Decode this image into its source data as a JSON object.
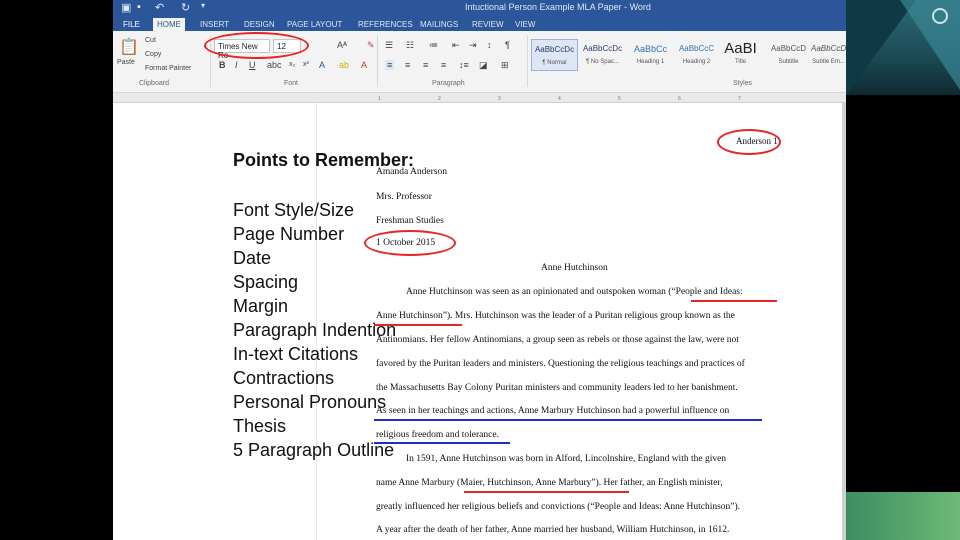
{
  "window": {
    "title": "Intuctional Person Example MLA Paper - Word"
  },
  "tabs": [
    "FILE",
    "HOME",
    "INSERT",
    "DESIGN",
    "PAGE LAYOUT",
    "REFERENCES",
    "MAILINGS",
    "REVIEW",
    "VIEW"
  ],
  "ribbon": {
    "clipboard": {
      "paste": "Paste",
      "cut": "Cut",
      "copy": "Copy",
      "format_painter": "Format Painter",
      "label": "Clipboard"
    },
    "font": {
      "name": "Times New Ro",
      "size": "12",
      "label": "Font"
    },
    "paragraph": {
      "label": "Paragraph"
    },
    "styles": [
      {
        "preview": "AaBbCcDc",
        "name": "¶ Normal"
      },
      {
        "preview": "AaBbCcDc",
        "name": "¶ No Spac..."
      },
      {
        "preview": "AaBbCc",
        "name": "Heading 1"
      },
      {
        "preview": "AaBbCcC",
        "name": "Heading 2"
      },
      {
        "preview": "AaBI",
        "name": "Title"
      },
      {
        "preview": "AaBbCcD",
        "name": "Subtitle"
      },
      {
        "preview": "AaBbCcD",
        "name": "Subtle Em..."
      }
    ],
    "styles_label": "Styles"
  },
  "ruler": [
    "1",
    "2",
    "3",
    "4",
    "5",
    "6",
    "7"
  ],
  "document": {
    "header": "Anderson 1",
    "heading": [
      "Amanda Anderson",
      "Mrs. Professor",
      "Freshman Studies",
      "1 October 2015"
    ],
    "title": "Anne Hutchinson",
    "body": [
      "Anne Hutchinson was seen as an opinionated and outspoken woman (“People and Ideas:",
      "Anne Hutchinson”). Mrs. Hutchinson was the leader of a Puritan religious group known as the",
      "Antinomians. Her fellow Antinomians, a group seen as rebels or those against the law, were not",
      "favored by the Puritan leaders and ministers. Questioning the religious teachings and practices of",
      "the Massachusetts Bay Colony Puritan ministers and community leaders led to her banishment.",
      "As seen in her teachings and actions, Anne Marbury Hutchinson had a powerful influence on",
      "religious freedom and tolerance.",
      "In 1591, Anne Hutchinson was born in Alford, Lincolnshire, England with the given",
      "name Anne Marbury (Maier, Hutchinson, Anne Marbury”). Her father, an English minister,",
      "greatly influenced her religious beliefs and convictions (“People and Ideas: Anne Hutchinson”).",
      "A year after the death of her father, Anne married her husband, William Hutchinson, in 1612."
    ]
  },
  "points": {
    "title": "Points to Remember:",
    "items": [
      "Font Style/Size",
      "Page Number",
      "Date",
      "Spacing",
      "Margin",
      "Paragraph Indention",
      "In-text Citations",
      "Contractions",
      "Personal Pronouns",
      "Thesis",
      "5 Paragraph Outline"
    ]
  }
}
